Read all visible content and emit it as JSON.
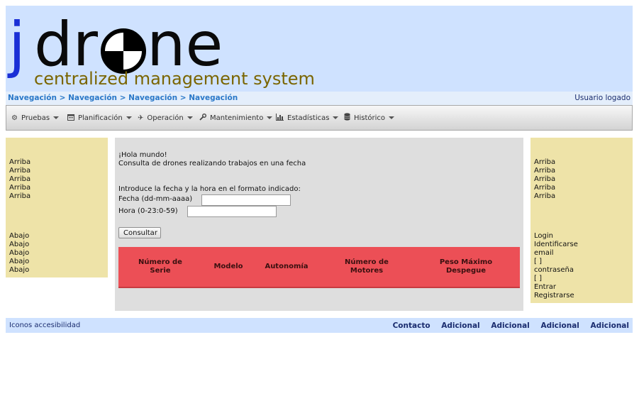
{
  "header": {
    "logo_text_before": "jdr",
    "logo_text_after": "ne",
    "subtitle": "centralized management system"
  },
  "breadcrumb": {
    "items": [
      "Navegación",
      "Navegación",
      "Navegación",
      "Navegación"
    ],
    "separator": ">"
  },
  "user": {
    "label": "Usuario logado"
  },
  "menu": [
    {
      "label": "Pruebas",
      "icon": "gear-icon"
    },
    {
      "label": "Planificación",
      "icon": "calendar-icon"
    },
    {
      "label": "Operación",
      "icon": "plane-icon"
    },
    {
      "label": "Mantenimiento",
      "icon": "wrench-icon"
    },
    {
      "label": "Estadísticas",
      "icon": "bar-chart-icon"
    },
    {
      "label": "Histórico",
      "icon": "database-icon"
    }
  ],
  "left_top_box": {
    "items": [
      "Arriba",
      "Arriba",
      "Arriba",
      "Arriba",
      "Arriba"
    ]
  },
  "left_bottom_box": {
    "items": [
      "Abajo",
      "Abajo",
      "Abajo",
      "Abajo",
      "Abajo"
    ]
  },
  "right_top_box": {
    "items": [
      "Arriba",
      "Arriba",
      "Arriba",
      "Arriba",
      "Arriba"
    ]
  },
  "login_box": {
    "login": "Login",
    "identify": "Identificarse",
    "email_label": "email",
    "email_value": "[ ]",
    "password_label": "contraseña",
    "password_value": "[ ]",
    "enter": "Entrar",
    "register": "Registrarse"
  },
  "main": {
    "greeting": "¡Hola mundo!",
    "description": "Consulta de drones realizando trabajos en una fecha",
    "instruction": "Introduce la fecha y la hora en el formato indicado:",
    "date_label": "Fecha (dd-mm-aaaa)",
    "date_value": "",
    "hour_label": "Hora (0-23:0-59)",
    "hour_value": "",
    "submit_label": "Consultar",
    "table_headers": [
      "Número de Serie",
      "Modelo",
      "Autonomía",
      "Número de Motores",
      "Peso Máximo Despegue"
    ]
  },
  "footer": {
    "accessibility": "Iconos accesibilidad",
    "links": [
      "Contacto",
      "Adicional",
      "Adicional",
      "Adicional",
      "Adicional"
    ]
  },
  "colors": {
    "header_bg": "#cfe2ff",
    "side_box_bg": "#eee3a8",
    "main_bg": "#dedede",
    "table_header_bg": "#ec4f56",
    "logo_j": "#1a2fd6",
    "subtitle": "#7a6500"
  }
}
